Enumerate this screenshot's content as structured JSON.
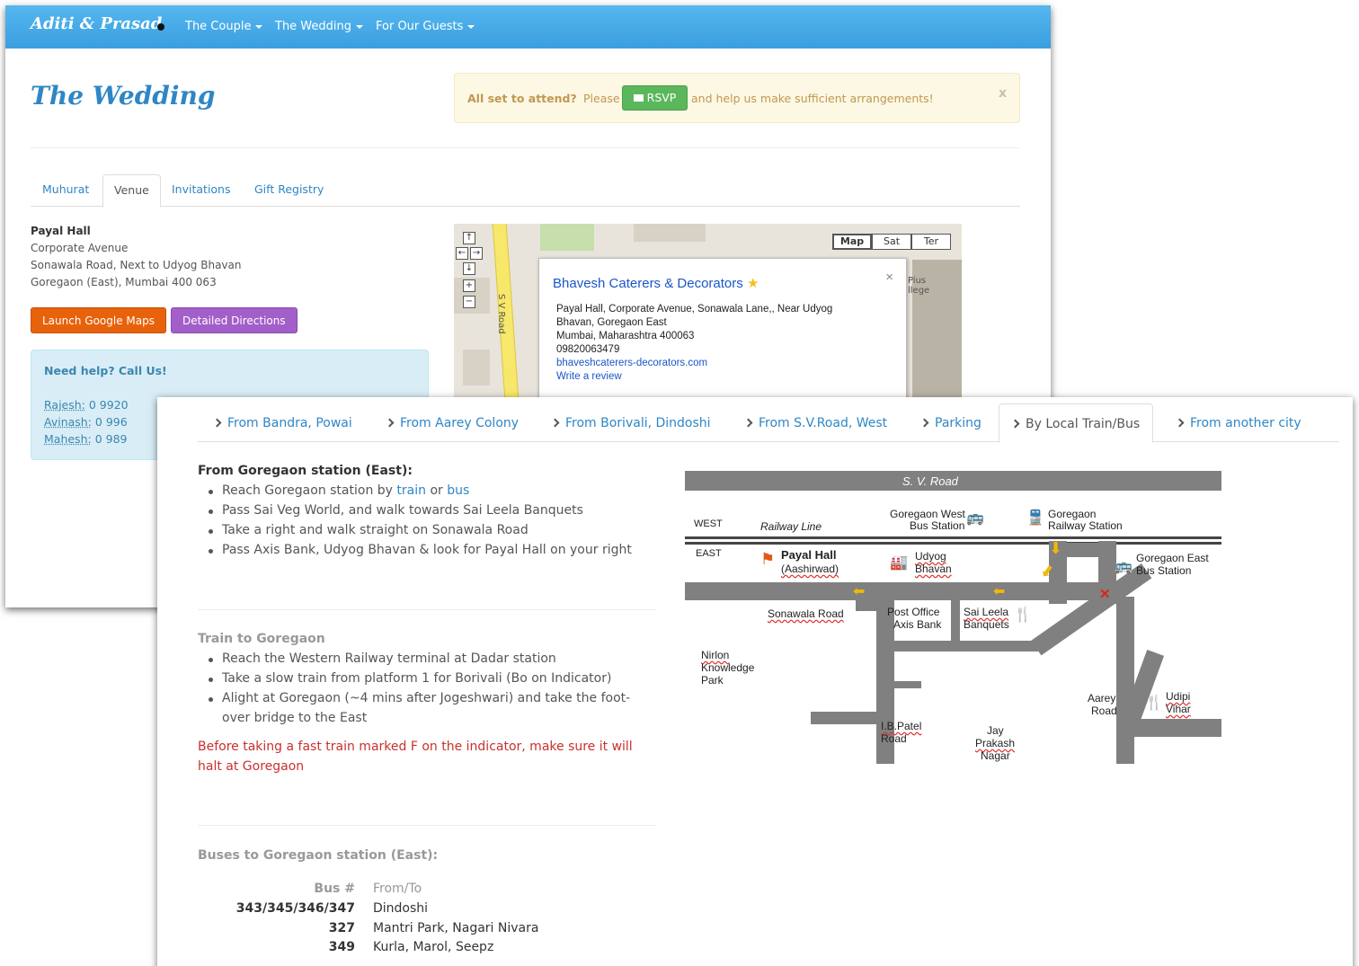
{
  "header": {
    "brand": "Aditi & Prasad",
    "menu": [
      {
        "label": "The Couple"
      },
      {
        "label": "The Wedding"
      },
      {
        "label": "For Our Guests"
      }
    ]
  },
  "page": {
    "title": "The Wedding",
    "alert": {
      "lead": "All set to attend?",
      "pre": "Please",
      "button": "RSVP",
      "post": "and help us make sufficient arrangements!",
      "close": "x"
    },
    "tabs": [
      "Muhurat",
      "Venue",
      "Invitations",
      "Gift Registry"
    ],
    "active_tab": "Venue"
  },
  "venue": {
    "name": "Payal Hall",
    "line1": "Corporate Avenue",
    "line2": "Sonawala Road, Next to Udyog Bhavan",
    "line3": "Goregaon (East), Mumbai 400 063",
    "btn_maps": "Launch Google Maps",
    "btn_directions": "Detailed Directions",
    "help_title": "Need help? Call Us!",
    "contacts": [
      {
        "name": "Rajesh:",
        "phone": "0 9920"
      },
      {
        "name": "Avinash:",
        "phone": "0 996"
      },
      {
        "name": "Mahesh:",
        "phone": "0 989"
      }
    ]
  },
  "map_widget": {
    "types": [
      "Map",
      "Sat",
      "Ter"
    ],
    "selected": "Map",
    "road_label": "S V Road",
    "pius_label": "Pius\nllege",
    "info": {
      "name": "Bhavesh Caterers & Decorators",
      "close": "×",
      "addr1": "Payal Hall, Corporate Avenue, Sonawala Lane,, Near Udyog",
      "addr2": "Bhavan, Goregaon East",
      "addr3": "Mumbai, Maharashtra 400063",
      "phone": "09820063479",
      "site": "bhaveshcaterers-decorators.com",
      "review": "Write a review"
    }
  },
  "directions": {
    "tabs": [
      "From Bandra, Powai",
      "From Aarey Colony",
      "From Borivali, Dindoshi",
      "From S.V.Road, West",
      "Parking",
      "By Local Train/Bus",
      "From another city"
    ],
    "active_tab": "By Local Train/Bus",
    "station_heading": "From Goregaon station (East):",
    "station_steps": {
      "s1_pre": "Reach Goregaon station by",
      "s1_train": "train",
      "s1_or": "or",
      "s1_bus": "bus",
      "s2": "Pass Sai Veg World, and walk towards Sai Leela Banquets",
      "s3": "Take a right and walk straight on Sonawala Road",
      "s4": "Pass Axis Bank, Udyog Bhavan & look for Payal Hall on your right"
    },
    "train_heading": "Train to Goregaon",
    "train_steps": [
      "Reach the Western Railway terminal at Dadar station",
      "Take a slow train from platform 1 for Borivali (Bo on Indicator)",
      "Alight at Goregaon (~4 mins after Jogeshwari) and take the foot-",
      "over bridge to the East"
    ],
    "warning_1": "Before taking a fast train marked F on the indicator, make sure it will",
    "warning_2": "halt at Goregaon",
    "bus_heading": "Buses to Goregaon station (East):",
    "bus_cols": [
      "Bus #",
      "From/To"
    ],
    "buses": [
      {
        "num": "343/345/346/347",
        "to": "Dindoshi"
      },
      {
        "num": "327",
        "to": "Mantri Park, Nagari Nivara"
      },
      {
        "num": "349",
        "to": "Kurla, Marol, Seepz"
      }
    ]
  },
  "schematic": {
    "sv_road": "S. V. Road",
    "west": "WEST",
    "east": "EAST",
    "railway": "Railway Line",
    "gw_bus_1": "Goregaon West",
    "gw_bus_2": "Bus Station",
    "gr_st_1": "Goregaon",
    "gr_st_2": "Railway Station",
    "payal_1": "Payal Hall",
    "payal_2": "(Aashirwad)",
    "udyog_1": "Udyog",
    "udyog_2": "Bhavan",
    "ge_bus_1": "Goregaon East",
    "ge_bus_2": "Bus Station",
    "sonawala": "Sonawala Road",
    "post_1": "Post Office",
    "post_2": "Axis Bank",
    "saileela_1": "Sai Leela",
    "saileela_2": "Banquets",
    "nirlon_1": "Nirlon",
    "nirlon_2": "Knowledge",
    "nirlon_3": "Park",
    "aarey_1": "Aarey",
    "aarey_2": "Road",
    "udipi_1": "Udipi",
    "udipi_2": "Vihar",
    "ib_1": "I.B.Patel",
    "ib_2": "Road",
    "jay_1": "Jay",
    "jay_2": "Prakash",
    "jay_3": "Nagar",
    "colors": {
      "road": "#808080",
      "arrow": "#f2b807",
      "cross": "#e02020"
    }
  }
}
